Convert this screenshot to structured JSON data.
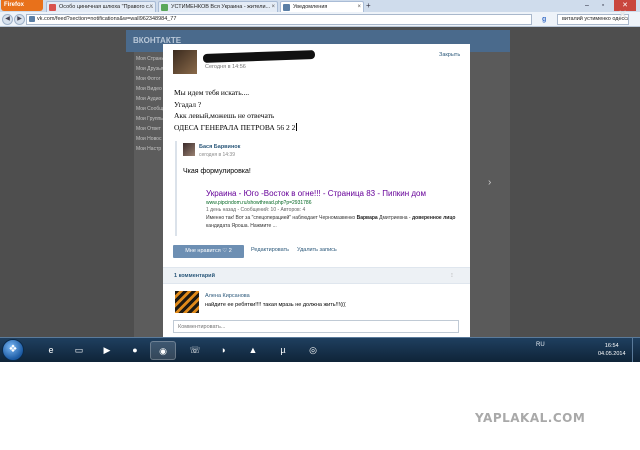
{
  "browser": {
    "menu_label": "Firefox",
    "tabs": [
      {
        "title": "Особо циничная шлюха \"Правого с...",
        "active": false,
        "color": "#d9534f"
      },
      {
        "title": "УСТИМЕНКОВ Вся Украина - жители...",
        "active": false,
        "color": "#5aa85a"
      },
      {
        "title": "Уведомления",
        "active": true,
        "color": "#5b7fa6"
      }
    ],
    "url": "vk.com/feed?section=notifications&w=wall962348984_77",
    "search_value": "виталий устименко одесса кэш"
  },
  "vk": {
    "logo": "ВКОНТАКТЕ",
    "left_menu": [
      "Моя Страни",
      "Мои Друзья",
      "Мои Фотог",
      "Мои Видео",
      "Мои Аудио",
      "Мои Сообщ",
      "Мои Группы",
      "Мои Ответ",
      "Мои Новос",
      "Мои Настр"
    ],
    "notification": {
      "time": "Сегодня в 14:56",
      "close_label": "Закрыть",
      "lines": [
        "Мы идем тебя искать....",
        "Угадал ?",
        "Акк левый,можешь не отвечать",
        "ОДЕСА ГЕНЕРАЛА ПЕТРОВА 56 2 2"
      ],
      "repost": {
        "author": "Бася Барвинок",
        "time": "сегодня в 14:39",
        "text": "Чкая формулировка!",
        "link": {
          "title": "Украина - Юго -Восток в огне!!! - Страница 83 - Пипкин дом",
          "url": "www.pipcindom.ru/showthread.php?p=2931786",
          "meta": "1 день назад - Сообщений: 10 - Авторов: 4",
          "snippet_start": "Именно так! Вот за \"спецоперацией\" наблюдает Черномазвенко ",
          "snippet_bold1": "Варвара",
          "snippet_mid": " Дмитриевна - ",
          "snippet_bold2": "доверенное лицо",
          "snippet_end": " кандидата Яроша. Нажмите ..."
        }
      },
      "like_label": "Мне нравится ♡ 2",
      "edit_label": "Редактировать",
      "delete_label": "Удалить запись",
      "comments_count": "1 комментарий",
      "comment": {
        "author": "Алена Кирсанова",
        "text": "найдите ее ребятки!!!! такая мразь не должна жить!!!((("
      },
      "comment_placeholder": "Комментировать..."
    }
  },
  "taskbar": {
    "lang": "RU",
    "time": "16:54",
    "date": "04.05.2014"
  },
  "watermark": "YAPLAKAL.COM"
}
